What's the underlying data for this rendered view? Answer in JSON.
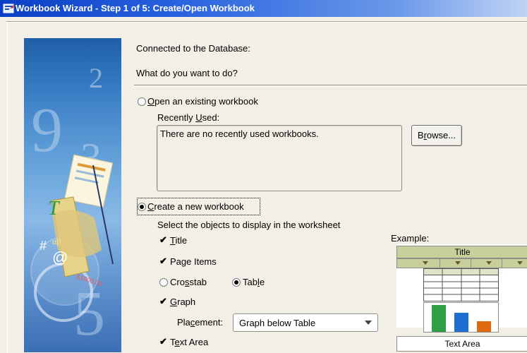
{
  "window": {
    "title": "Workbook Wizard - Step 1 of 5: Create/Open Workbook",
    "icon": "wizard-window-icon"
  },
  "header": {
    "connected_label": "Connected to the Database:",
    "question": "What do you want to do?"
  },
  "open_existing": {
    "prefix": "",
    "mnemonic": "O",
    "rest": "pen an existing workbook",
    "selected": false,
    "recently_used_prefix": "Recently ",
    "recently_used_mnemonic": "U",
    "recently_used_rest": "sed:",
    "recent_list_message": "There are no recently used workbooks.",
    "browse_prefix": "B",
    "browse_mnemonic": "r",
    "browse_rest": "owse..."
  },
  "create_new": {
    "mnemonic": "C",
    "rest": "reate a new workbook",
    "selected": true,
    "instructions": "Select the objects to display in the worksheet",
    "objects": {
      "title": {
        "mnemonic": "T",
        "rest": "itle",
        "checked": true
      },
      "page_items": {
        "prefix": "Pa",
        "mnemonic": "g",
        "rest": "e Items",
        "checked": true
      },
      "crosstab": {
        "prefix": "Cro",
        "mnemonic": "s",
        "rest": "stab",
        "selected": false
      },
      "table": {
        "prefix": "Tab",
        "mnemonic": "l",
        "rest": "e",
        "selected": true
      },
      "graph": {
        "mnemonic": "G",
        "rest": "raph",
        "checked": true
      },
      "text_area": {
        "prefix": "T",
        "mnemonic": "e",
        "rest": "xt Area",
        "checked": true
      }
    },
    "placement": {
      "prefix": "Pla",
      "mnemonic": "c",
      "rest": "ement:",
      "value": "Graph below Table"
    }
  },
  "example": {
    "label": "Example:",
    "title": "Title",
    "text_area": "Text Area",
    "bar_colors": [
      "#2ea043",
      "#1f6fd1",
      "#e06a10"
    ]
  },
  "glyphs": {
    "check": "✔"
  }
}
